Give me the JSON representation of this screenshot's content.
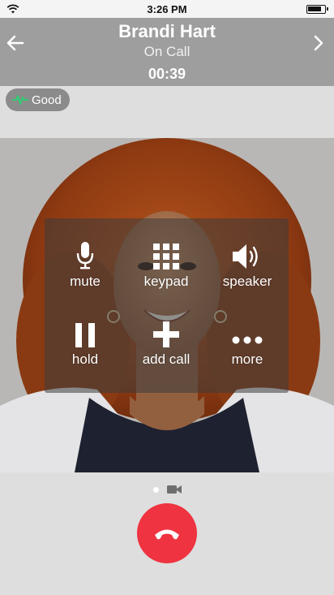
{
  "status_bar": {
    "time": "3:26 PM",
    "icons": [
      "wifi-icon",
      "battery-icon"
    ]
  },
  "header": {
    "contact_name": "Brandi Hart",
    "call_state": "On Call",
    "duration": "00:39",
    "icons": [
      "arrow-left-icon",
      "chevron-right-icon"
    ]
  },
  "quality": {
    "label": "Good",
    "color": "#2ecc71",
    "icon": "pulse-icon"
  },
  "controls": [
    {
      "label": "mute",
      "icon": "microphone-icon"
    },
    {
      "label": "keypad",
      "icon": "keypad-icon"
    },
    {
      "label": "speaker",
      "icon": "speaker-icon"
    },
    {
      "label": "hold",
      "icon": "pause-icon"
    },
    {
      "label": "add call",
      "icon": "plus-icon"
    },
    {
      "label": "more",
      "icon": "more-icon"
    }
  ],
  "bottom": {
    "page_indicators": [
      "dot-icon",
      "video-camera-icon"
    ],
    "hangup_icon": "phone-hangup-icon",
    "hangup_color": "#ef3340"
  }
}
